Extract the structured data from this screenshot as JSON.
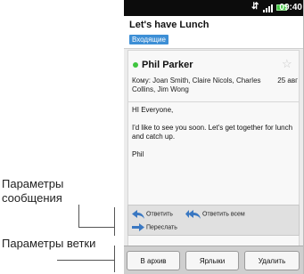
{
  "annotations": {
    "message_options": "Параметры сообщения",
    "thread_options": "Параметры ветки"
  },
  "statusbar": {
    "time": "09:40",
    "icons": [
      "usb-icon",
      "signal-icon",
      "battery-icon"
    ]
  },
  "header": {
    "subject": "Let's have Lunch",
    "label": "Входящие"
  },
  "message": {
    "sender": "Phil Parker",
    "recipients": "Кому: Joan Smith, Claire Nicols, Charles Collins, Jim Wong",
    "date": "25 авг",
    "greeting": "HI Everyone,",
    "text": "I'd like to see you soon. Let's get together for lunch and catch up.",
    "signature": "Phil"
  },
  "message_actions": {
    "reply": "Ответить",
    "reply_all": "Ответить всем",
    "forward": "Переслать"
  },
  "thread_actions": {
    "archive": "В архив",
    "labels": "Ярлыки",
    "delete": "Удалить"
  },
  "colors": {
    "label_badge": "#3d8fd6",
    "presence_online": "#3fc53f",
    "reply_arrow": "#3a78c2",
    "forward_arrow": "#3a78c2"
  }
}
